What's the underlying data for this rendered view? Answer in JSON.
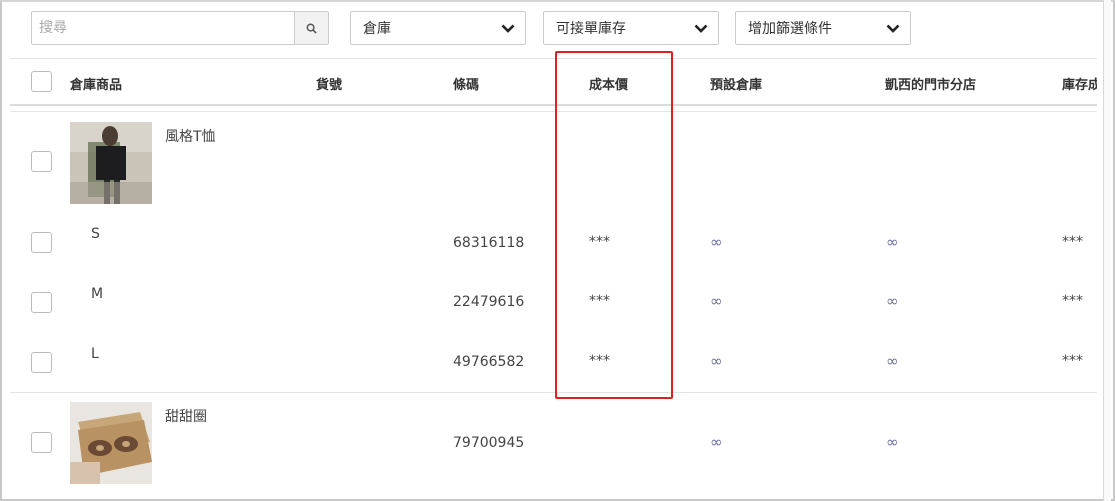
{
  "toolbar": {
    "search_placeholder": "搜尋",
    "warehouse_dropdown": "倉庫",
    "stock_dropdown": "可接單庫存",
    "filter_dropdown": "增加篩選條件"
  },
  "columns": [
    "倉庫商品",
    "貨號",
    "條碼",
    "成本價",
    "預設倉庫",
    "凱西的門市分店",
    "庫存成"
  ],
  "products": [
    {
      "name": "風格T恤",
      "variants": [
        {
          "label": "S",
          "barcode": "68316118",
          "cost": "***",
          "default_wh": "∞",
          "branch": "∞",
          "stock_cost": "***"
        },
        {
          "label": "M",
          "barcode": "22479616",
          "cost": "***",
          "default_wh": "∞",
          "branch": "∞",
          "stock_cost": "***"
        },
        {
          "label": "L",
          "barcode": "49766582",
          "cost": "***",
          "default_wh": "∞",
          "branch": "∞",
          "stock_cost": "***"
        }
      ]
    },
    {
      "name": "甜甜圈",
      "barcode": "79700945",
      "default_wh": "∞",
      "branch": "∞"
    }
  ],
  "colors": {
    "highlight": "#e02020",
    "infinity": "#6a6f9c"
  }
}
